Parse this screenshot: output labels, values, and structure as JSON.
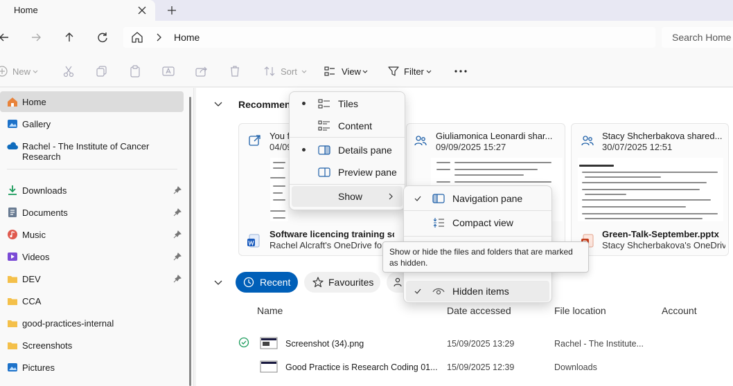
{
  "tab": {
    "title": "Home"
  },
  "address": {
    "crumb": "Home",
    "search_placeholder": "Search Home"
  },
  "toolbar": {
    "new": "New",
    "sort": "Sort",
    "view": "View",
    "filter": "Filter"
  },
  "sidebar": {
    "items": [
      {
        "label": "Home",
        "icon": "home-icon",
        "color": "#e8833a"
      },
      {
        "label": "Gallery",
        "icon": "gallery-icon",
        "color": "#1d72c9"
      },
      {
        "label": "Rachel - The Institute of Cancer Research",
        "icon": "onedrive-icon",
        "color": "#0f6cbd"
      },
      {
        "label": "Downloads",
        "icon": "download-icon",
        "color": "#1a9b5b"
      },
      {
        "label": "Documents",
        "icon": "documents-icon",
        "color": "#6a7c93"
      },
      {
        "label": "Music",
        "icon": "music-icon",
        "color": "#e05a4f"
      },
      {
        "label": "Videos",
        "icon": "videos-icon",
        "color": "#7b4bd6"
      },
      {
        "label": "DEV",
        "icon": "folder-icon",
        "color": "#f4c04a"
      },
      {
        "label": "CCA",
        "icon": "folder-icon",
        "color": "#f4c04a"
      },
      {
        "label": "good-practices-internal",
        "icon": "folder-icon",
        "color": "#f4c04a"
      },
      {
        "label": "Screenshots",
        "icon": "folder-icon",
        "color": "#f4c04a"
      },
      {
        "label": "Pictures",
        "icon": "pictures-icon",
        "color": "#1d72c9"
      }
    ]
  },
  "recommended": {
    "title": "Recommen",
    "cards": [
      {
        "sharer": "You fi",
        "date": "04/09",
        "file": "Software licencing training sce...",
        "owner": "Rachel Alcraft's OneDrive for Bu"
      },
      {
        "sharer": "Giuliamonica Leonardi shar...",
        "date": "09/09/2025 15:27",
        "file": "",
        "owner": ""
      },
      {
        "sharer": "Stacy Shcherbakova shared...",
        "date": "30/07/2025 12:51",
        "file": "Green-Talk-September.pptx",
        "owner": "Stacy Shcherbakova's OneDrive..."
      }
    ]
  },
  "filters": {
    "recent": "Recent",
    "favourites": "Favourites"
  },
  "columns": {
    "name": "Name",
    "date": "Date accessed",
    "location": "File location",
    "account": "Account"
  },
  "rows": [
    {
      "name": "Screenshot (34).png",
      "date": "15/09/2025 13:29",
      "location": "Rachel - The Institute..."
    },
    {
      "name": "Good Practice is Research Coding 01...",
      "date": "15/09/2025 12:39",
      "location": "Downloads"
    }
  ],
  "view_menu": {
    "tiles": "Tiles",
    "content": "Content",
    "details_pane": "Details pane",
    "preview_pane": "Preview pane",
    "show": "Show"
  },
  "show_menu": {
    "navigation_pane": "Navigation pane",
    "compact_view": "Compact view",
    "hidden_items": "Hidden items"
  },
  "tooltip": "Show or hide the files and folders that are marked as hidden.",
  "colors": {
    "accent": "#005fb8",
    "check": "#1a9b5b"
  }
}
